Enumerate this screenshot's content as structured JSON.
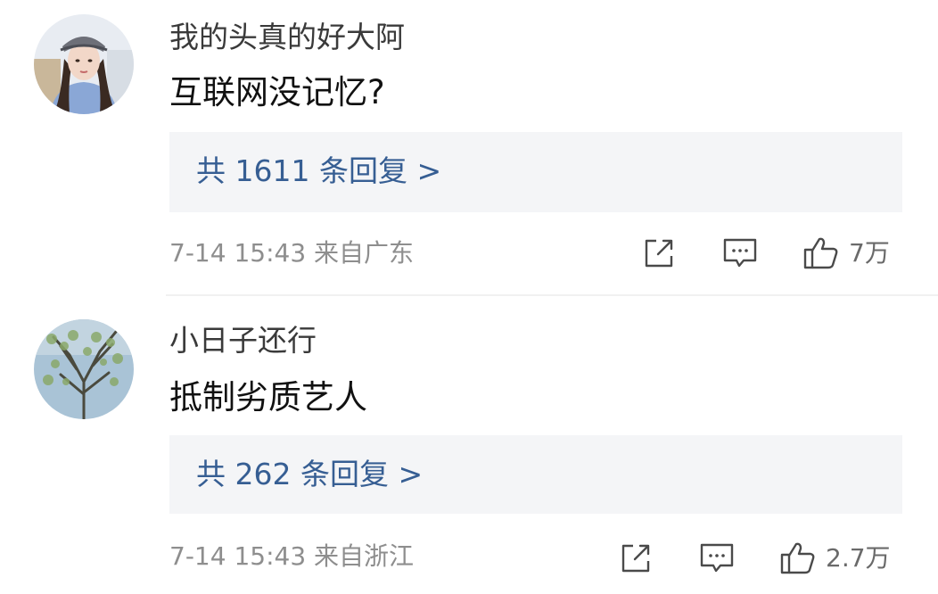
{
  "comments": [
    {
      "username": "我的头真的好大阿",
      "content": "互联网没记忆?",
      "replies_label": "共 1611 条回复 >",
      "meta": "7-14 15:43 来自广东",
      "likes": "7万"
    },
    {
      "username": "小日子还行",
      "content": "抵制劣质艺人",
      "replies_label": "共 262 条回复 >",
      "meta": "7-14 15:43 来自浙江",
      "likes": "2.7万"
    }
  ],
  "icons": {
    "share": "share-icon",
    "comment": "comment-icon",
    "like": "thumbs-up-icon"
  },
  "colors": {
    "reply_link": "#365e93",
    "reply_bg": "#f4f5f7",
    "meta_text": "#8e8e8e",
    "icon_stroke": "#4a4a4a"
  }
}
